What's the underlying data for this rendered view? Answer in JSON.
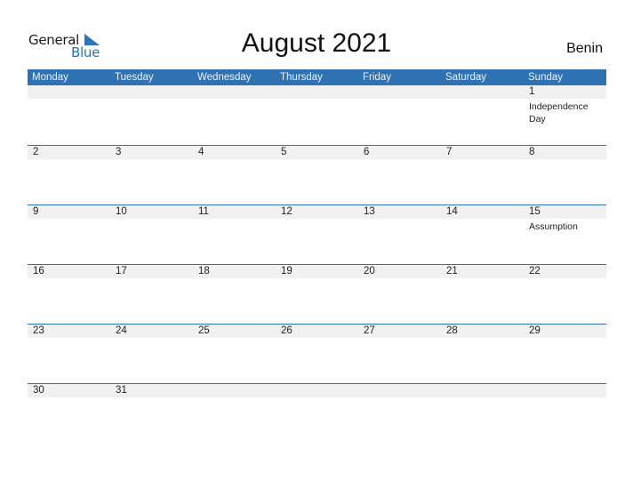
{
  "logo": {
    "line1": "General",
    "line2": "Blue"
  },
  "title": "August 2021",
  "country": "Benin",
  "weekdays": [
    "Monday",
    "Tuesday",
    "Wednesday",
    "Thursday",
    "Friday",
    "Saturday",
    "Sunday"
  ],
  "weeks": [
    [
      {
        "d": ""
      },
      {
        "d": ""
      },
      {
        "d": ""
      },
      {
        "d": ""
      },
      {
        "d": ""
      },
      {
        "d": ""
      },
      {
        "d": "1",
        "h": "Independence Day"
      }
    ],
    [
      {
        "d": "2"
      },
      {
        "d": "3"
      },
      {
        "d": "4"
      },
      {
        "d": "5"
      },
      {
        "d": "6"
      },
      {
        "d": "7"
      },
      {
        "d": "8"
      }
    ],
    [
      {
        "d": "9"
      },
      {
        "d": "10"
      },
      {
        "d": "11"
      },
      {
        "d": "12"
      },
      {
        "d": "13"
      },
      {
        "d": "14"
      },
      {
        "d": "15",
        "h": "Assumption"
      }
    ],
    [
      {
        "d": "16"
      },
      {
        "d": "17"
      },
      {
        "d": "18"
      },
      {
        "d": "19"
      },
      {
        "d": "20"
      },
      {
        "d": "21"
      },
      {
        "d": "22"
      }
    ],
    [
      {
        "d": "23"
      },
      {
        "d": "24"
      },
      {
        "d": "25"
      },
      {
        "d": "26"
      },
      {
        "d": "27"
      },
      {
        "d": "28"
      },
      {
        "d": "29"
      }
    ],
    [
      {
        "d": "30"
      },
      {
        "d": "31"
      },
      {
        "d": ""
      },
      {
        "d": ""
      },
      {
        "d": ""
      },
      {
        "d": ""
      },
      {
        "d": ""
      }
    ]
  ],
  "colors": {
    "accent": "#2e72b4",
    "band": "#f1f1f1"
  }
}
